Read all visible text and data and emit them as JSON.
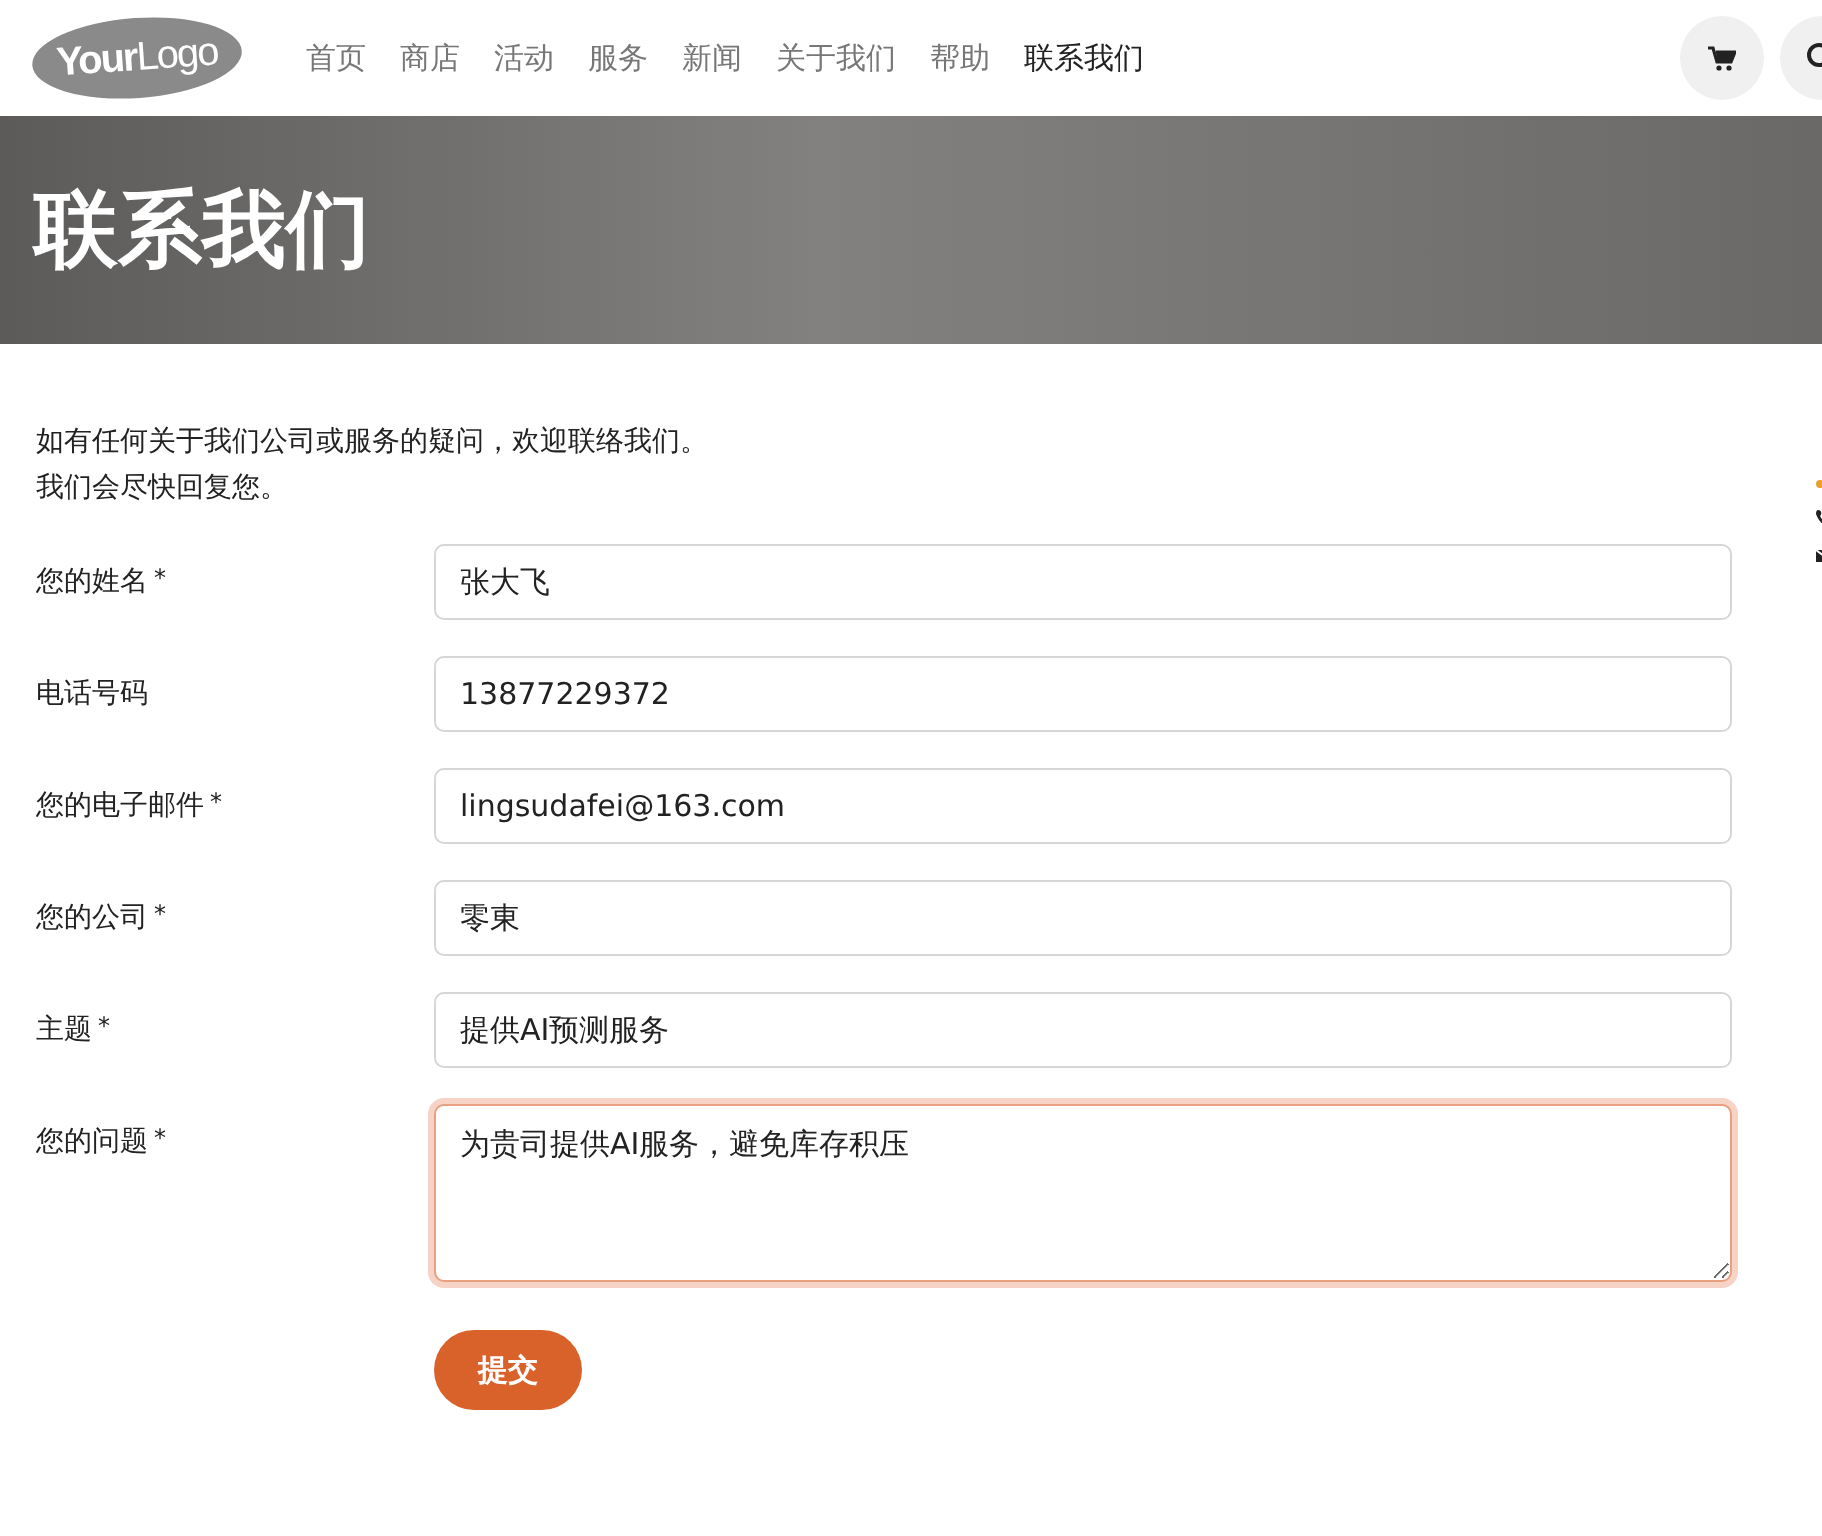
{
  "header": {
    "logo": {
      "bold": "Your",
      "light": "Logo"
    },
    "nav": [
      {
        "label": "首页",
        "selected": false
      },
      {
        "label": "商店",
        "selected": false
      },
      {
        "label": "活动",
        "selected": false
      },
      {
        "label": "服务",
        "selected": false
      },
      {
        "label": "新闻",
        "selected": false
      },
      {
        "label": "关于我们",
        "selected": false
      },
      {
        "label": "帮助",
        "selected": false
      },
      {
        "label": "联系我们",
        "selected": true
      }
    ]
  },
  "hero": {
    "title": "联系我们"
  },
  "intro": [
    "如有任何关于我们公司或服务的疑问，欢迎联络我们。",
    "我们会尽快回复您。"
  ],
  "fields": [
    {
      "kind": "input",
      "label": "您的姓名",
      "mark": "*",
      "value": "张大飞",
      "focused": false
    },
    {
      "kind": "input",
      "label": "电话号码",
      "value": "13877229372",
      "focused": false
    },
    {
      "kind": "input",
      "label": "您的电子邮件",
      "mark": "*",
      "value": "lingsudafei@163.com",
      "focused": false
    },
    {
      "kind": "input",
      "label": "您的公司",
      "mark": "*",
      "value": "零東",
      "focused": false
    },
    {
      "kind": "input",
      "label": "主题",
      "mark": "*",
      "value": "提供AI预测服务",
      "focused": false
    },
    {
      "kind": "textarea",
      "label": "您的问题",
      "mark": "*",
      "value": "为贵司提供AI服务，避免库存积压",
      "focused": true
    }
  ],
  "submit": {
    "label": "提交"
  }
}
